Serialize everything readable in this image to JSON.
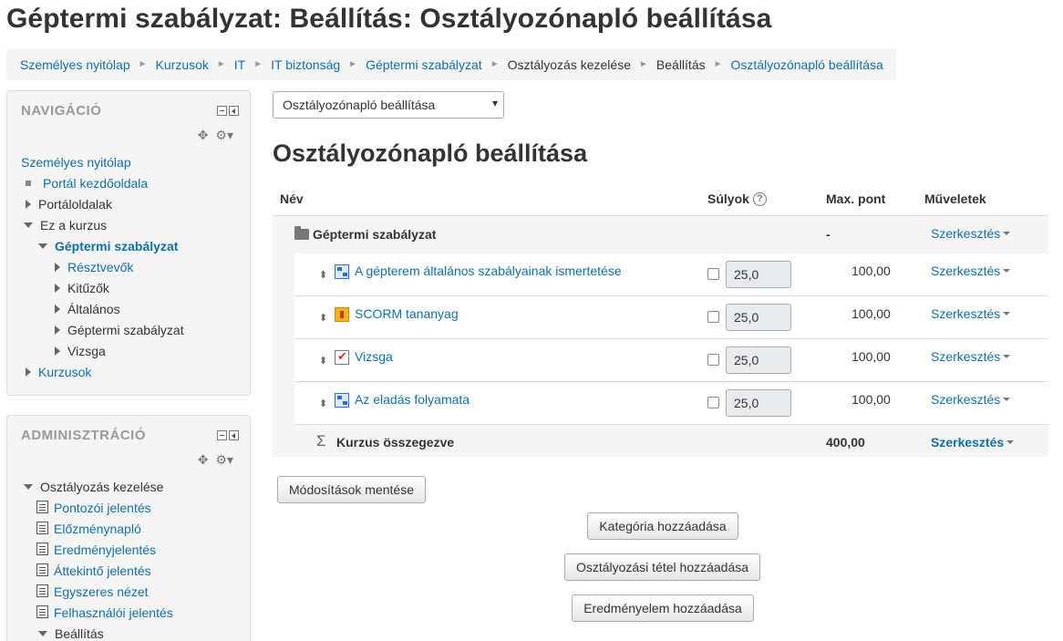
{
  "page_title": "Géptermi szabályzat: Beállítás: Osztályozónapló beállítása",
  "breadcrumb": [
    {
      "label": "Személyes nyitólap",
      "link": true
    },
    {
      "label": "Kurzusok",
      "link": true
    },
    {
      "label": "IT",
      "link": true
    },
    {
      "label": "IT biztonság",
      "link": true
    },
    {
      "label": "Géptermi szabályzat",
      "link": true
    },
    {
      "label": "Osztályozás kezelése",
      "link": false
    },
    {
      "label": "Beállítás",
      "link": false
    },
    {
      "label": "Osztályozónapló beállítása",
      "link": true
    }
  ],
  "nav_block": {
    "title": "NAVIGÁCIÓ",
    "items": [
      {
        "label": "Személyes nyitólap"
      },
      {
        "label": "Portál kezdőoldala"
      },
      {
        "label": "Portáloldalak"
      },
      {
        "label": "Ez a kurzus"
      },
      {
        "label": "Géptermi szabályzat"
      },
      {
        "label": "Résztvevők"
      },
      {
        "label": "Kitűzők"
      },
      {
        "label": "Általános"
      },
      {
        "label": "Géptermi szabályzat"
      },
      {
        "label": "Vizsga"
      },
      {
        "label": "Kurzusok"
      }
    ]
  },
  "admin_block": {
    "title": "ADMINISZTRÁCIÓ",
    "items": [
      {
        "label": "Osztályozás kezelése"
      },
      {
        "label": "Pontozói jelentés"
      },
      {
        "label": "Előzménynapló"
      },
      {
        "label": "Eredményjelentés"
      },
      {
        "label": "Áttekintő jelentés"
      },
      {
        "label": "Egyszeres nézet"
      },
      {
        "label": "Felhasználói jelentés"
      },
      {
        "label": "Beállítás"
      }
    ]
  },
  "select": {
    "value": "Osztályozónapló beállítása"
  },
  "heading": "Osztályozónapló beállítása",
  "table": {
    "headers": {
      "name": "Név",
      "weights": "Súlyok",
      "max": "Max. pont",
      "actions": "Műveletek"
    },
    "help_icon": "?",
    "category": {
      "name": "Géptermi szabályzat",
      "max": "-",
      "action": "Szerkesztés"
    },
    "items": [
      {
        "name": "A gépterem általános szabályainak ismertetése",
        "icon": "lesson-icon",
        "weight": "25,0",
        "max": "100,00",
        "action": "Szerkesztés"
      },
      {
        "name": "SCORM tananyag",
        "icon": "scorm-icon",
        "weight": "25,0",
        "max": "100,00",
        "action": "Szerkesztés"
      },
      {
        "name": "Vizsga",
        "icon": "quiz-icon",
        "weight": "25,0",
        "max": "100,00",
        "action": "Szerkesztés"
      },
      {
        "name": "Az eladás folyamata",
        "icon": "lesson-icon",
        "weight": "25,0",
        "max": "100,00",
        "action": "Szerkesztés"
      }
    ],
    "total": {
      "symbol": "Σ",
      "name": "Kurzus összegezve",
      "max": "400,00",
      "action": "Szerkesztés"
    }
  },
  "buttons": {
    "save": "Módosítások mentése",
    "add_category": "Kategória hozzáadása",
    "add_item": "Osztályozási tétel hozzáadása",
    "add_outcome": "Eredményelem hozzáadása"
  },
  "colors": {
    "link": "#0f6fab",
    "block_bg": "#f5f5f5",
    "table_bg": "#f5f5f5"
  }
}
